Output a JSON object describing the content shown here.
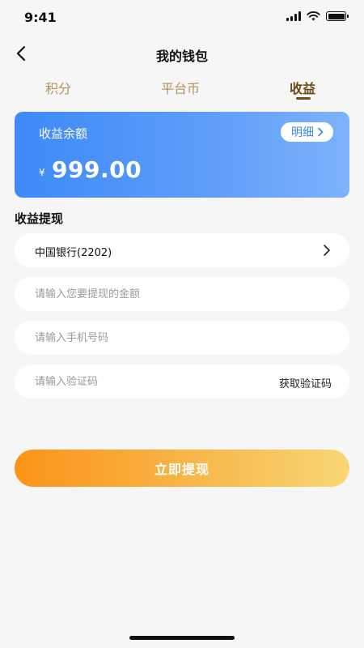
{
  "status_bar": {
    "time": "9:41"
  },
  "nav": {
    "title": "我的钱包"
  },
  "tabs": [
    {
      "label": "积分"
    },
    {
      "label": "平台币"
    },
    {
      "label": "收益",
      "active": true
    }
  ],
  "balance_card": {
    "label": "收益余额",
    "detail_label": "明细",
    "currency": "¥",
    "amount": "999.00"
  },
  "withdraw": {
    "section_title": "收益提现",
    "bank_account": "中国银行(2202)",
    "amount_placeholder": "请输入您要提现的金额",
    "phone_placeholder": "请输入手机号码",
    "code_placeholder": "请输入验证码",
    "get_code_label": "获取验证码",
    "submit_label": "立即提现"
  },
  "colors": {
    "card_gradient_start": "#3d8af8",
    "card_gradient_end": "#7eb2fb",
    "button_gradient_start": "#fb9417",
    "button_gradient_end": "#f7d774",
    "tab_active": "#6b4a14",
    "tab_inactive": "#b3935c"
  },
  "icons": [
    "back-arrow-icon",
    "chevron-right-icon",
    "signal-icon",
    "wifi-icon",
    "battery-icon"
  ]
}
